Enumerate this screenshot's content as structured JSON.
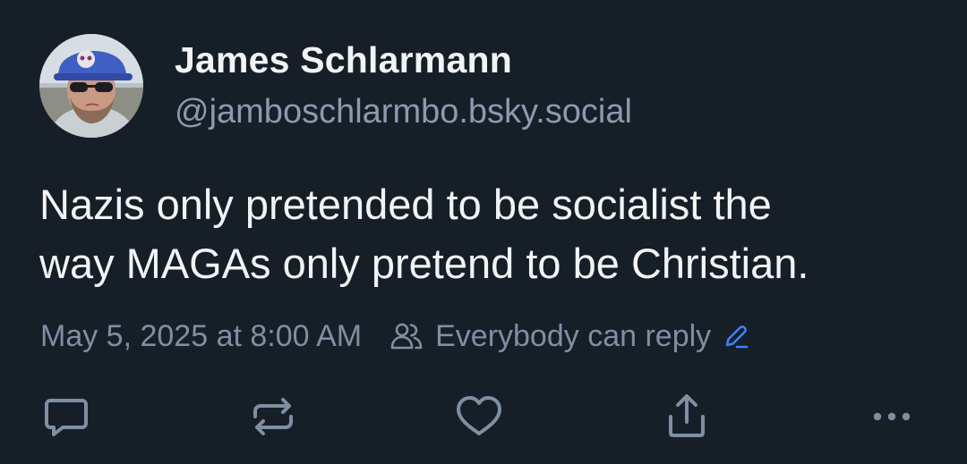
{
  "post": {
    "author": {
      "display_name": "James Schlarmann",
      "handle": "@jamboschlarmbo.bsky.social"
    },
    "text_lines": [
      "Nazis only pretended to be socialist the",
      "way MAGAs only pretend to be Christian."
    ],
    "timestamp": "May 5, 2025 at 8:00 AM",
    "reply_setting": "Everybody can reply"
  },
  "icons": {
    "reply_setting": "people-icon",
    "edit": "pencil-icon",
    "actions": [
      "reply-icon",
      "repost-icon",
      "like-icon",
      "share-icon",
      "more-options-icon"
    ]
  },
  "colors": {
    "background": "#161e27",
    "text_primary": "#f1f3f5",
    "text_secondary": "#8a9bb0",
    "icon": "#7f8fa3",
    "accent": "#3b82f6"
  }
}
